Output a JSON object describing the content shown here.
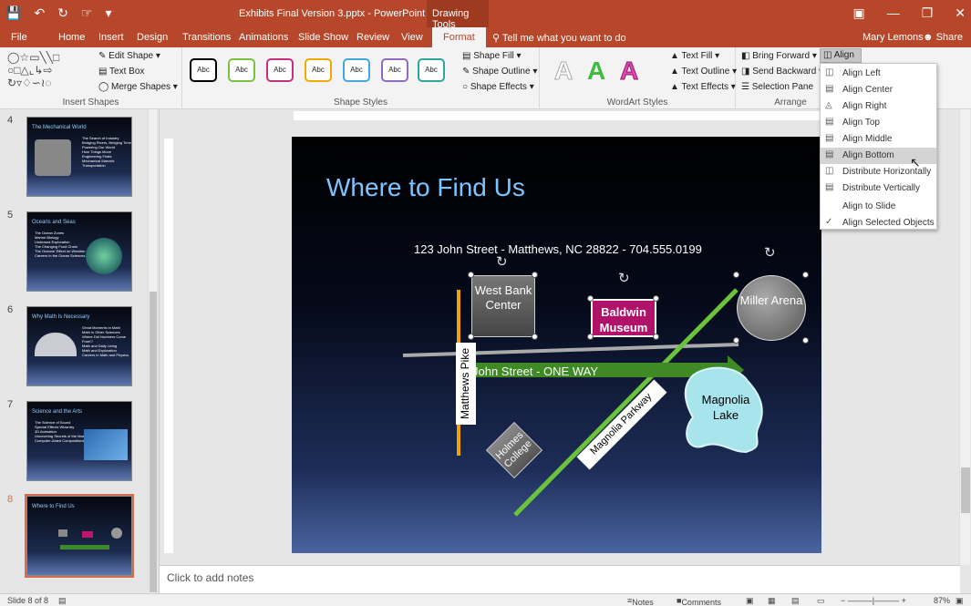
{
  "app": {
    "doc_title": "Exhibits Final Version 3.pptx - PowerPoint",
    "context_tab": "Drawing Tools"
  },
  "tabs": [
    "File",
    "Home",
    "Insert",
    "Design",
    "Transitions",
    "Animations",
    "Slide Show",
    "Review",
    "View",
    "Format"
  ],
  "active_tab": "Format",
  "tell_me": "Tell me what you want to do",
  "user": "Mary Lemons",
  "share": "Share",
  "ribbon": {
    "insert_shapes": {
      "label": "Insert Shapes",
      "edit_shape": "Edit Shape",
      "text_box": "Text Box",
      "merge_shapes": "Merge Shapes"
    },
    "shape_styles": {
      "label": "Shape Styles",
      "swatch_text": "Abc",
      "swatch_colors": [
        "#000000",
        "#7cc242",
        "#c6307c",
        "#f2a900",
        "#3fa9e0",
        "#8e6bbf",
        "#2ba79b"
      ],
      "fill": "Shape Fill",
      "outline": "Shape Outline",
      "effects": "Shape Effects"
    },
    "wordart": {
      "label": "WordArt Styles",
      "letter": "A",
      "text_fill": "Text Fill",
      "text_outline": "Text Outline",
      "text_effects": "Text Effects"
    },
    "arrange": {
      "label": "Arrange",
      "bring_forward": "Bring Forward",
      "send_backward": "Send Backward",
      "selection_pane": "Selection Pane",
      "align": "Align"
    }
  },
  "align_menu": [
    {
      "label": "Align Left",
      "icon": "align-left-icon"
    },
    {
      "label": "Align Center",
      "icon": "align-center-icon"
    },
    {
      "label": "Align Right",
      "icon": "align-right-icon"
    },
    {
      "label": "Align Top",
      "icon": "align-top-icon"
    },
    {
      "label": "Align Middle",
      "icon": "align-middle-icon"
    },
    {
      "label": "Align Bottom",
      "icon": "align-bottom-icon"
    },
    {
      "label": "Distribute Horizontally",
      "icon": "distribute-horizontally-icon"
    },
    {
      "label": "Distribute Vertically",
      "icon": "distribute-vertically-icon"
    },
    {
      "label": "Align to Slide",
      "icon": ""
    },
    {
      "label": "Align Selected Objects",
      "icon": "checkmark-icon"
    }
  ],
  "align_menu_hover": "Align Bottom",
  "thumbnails": [
    {
      "num": "4",
      "title": "The Mechanical World",
      "bullets": [
        "The Search of Industry",
        "Bridging Rivers, Bridging Time",
        "Powering Our World",
        "How Things Move",
        "Engineering Feats",
        "Mechanical Marvels",
        "Transportation"
      ]
    },
    {
      "num": "5",
      "title": "Oceans and Seas",
      "bullets": [
        "The Ocean Zones",
        "Marine Biology",
        "Undersea Exploration",
        "The Changing Food Chain",
        "The Oceans' Effect on Weather",
        "Careers in the Ocean Sciences"
      ]
    },
    {
      "num": "6",
      "title": "Why Math Is Necessary",
      "bullets": [
        "Great Moments in Math",
        "Math in Other Sciences",
        "Where Did Numbers Come From?",
        "Math and Daily Living",
        "Math and Exploration",
        "Careers in Math and Physics"
      ]
    },
    {
      "num": "7",
      "title": "Science and the Arts",
      "bullets": [
        "The Science of Sound",
        "Special Effects Wizardry",
        "3D Animation",
        "Uncovering Secrets of the Masters",
        "Computer-Aided Compositions"
      ]
    },
    {
      "num": "8",
      "title": "Where to Find Us",
      "bullets": []
    }
  ],
  "slide": {
    "title": "Where to Find Us",
    "address": "123 John Street  -  Matthews, NC 28822  -  704.555.0199",
    "west_bank": "West Bank Center",
    "baldwin": "Baldwin Museum",
    "miller": "Miller Arena",
    "matthews_pike": "Matthews Pike",
    "john_street": "John Street - ONE WAY",
    "magnolia_pkwy": "Magnolia Parkway",
    "holmes": "Holmes College",
    "magnolia_lake": "Magnolia Lake"
  },
  "notes_placeholder": "Click to add notes",
  "status": {
    "slide_of": "Slide 8 of 8",
    "notes": "Notes",
    "comments": "Comments",
    "zoom": "87%"
  }
}
